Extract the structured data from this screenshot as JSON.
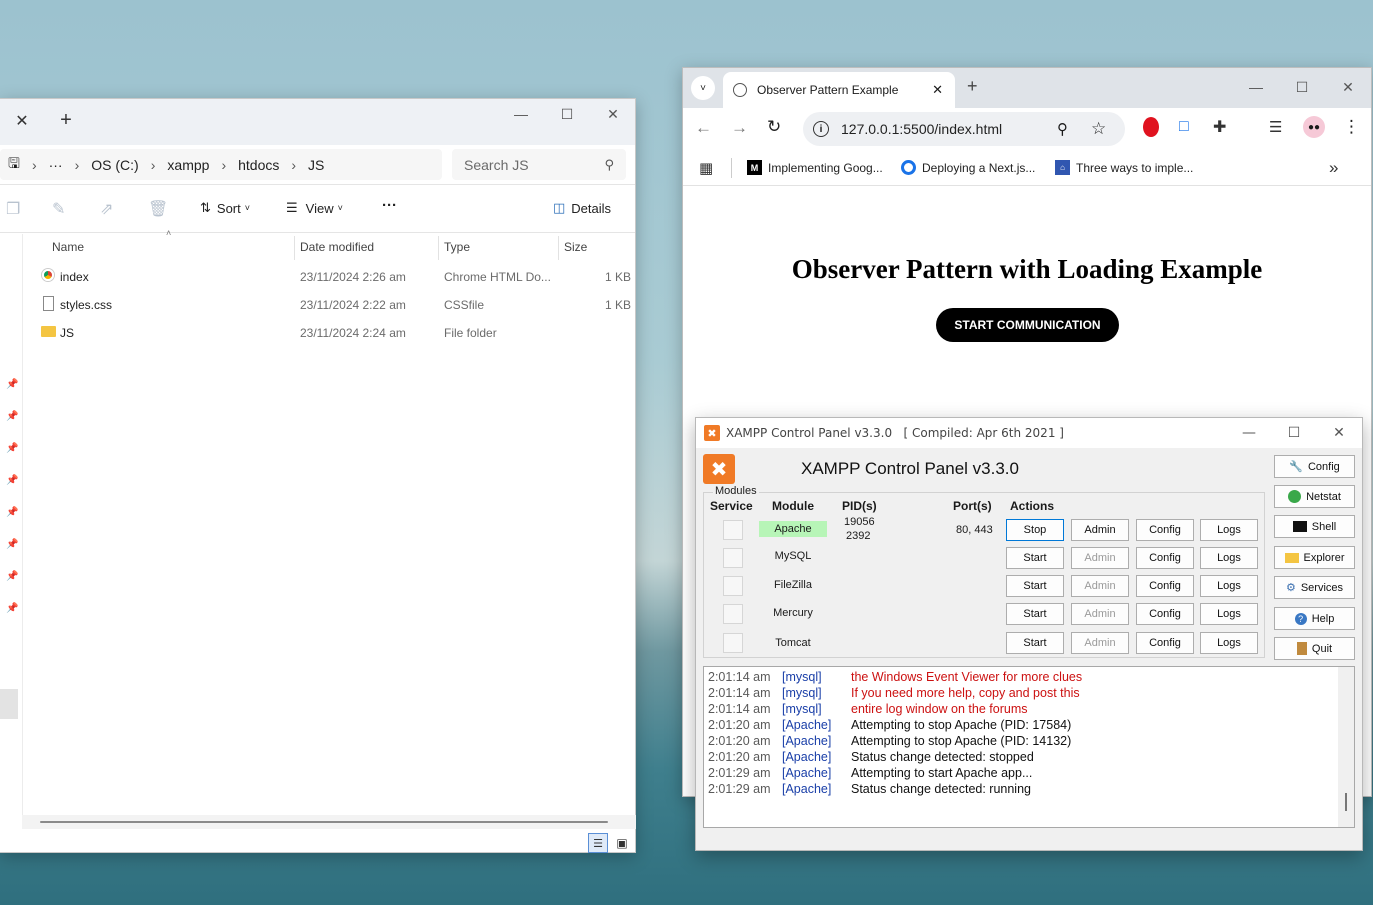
{
  "explorer": {
    "tab_close": "✕",
    "tab_new": "+",
    "breadcrumbs": [
      "OS (C:)",
      "xampp",
      "htdocs",
      "JS"
    ],
    "more": "···",
    "search_placeholder": "Search JS",
    "toolbar": {
      "sort": "Sort",
      "view": "View",
      "more": "···",
      "details": "Details"
    },
    "columns": {
      "name": "Name",
      "date": "Date modified",
      "type": "Type",
      "size": "Size"
    },
    "files": [
      {
        "name": "index",
        "date": "23/11/2024 2:26 am",
        "type": "Chrome HTML Do...",
        "size": "1 KB",
        "icon": "chrome-html-icon"
      },
      {
        "name": "styles.css",
        "date": "23/11/2024 2:22 am",
        "type": "CSSfile",
        "size": "1 KB",
        "icon": "file-icon"
      },
      {
        "name": "JS",
        "date": "23/11/2024 2:24 am",
        "type": "File folder",
        "size": "",
        "icon": "folder-icon"
      }
    ]
  },
  "browser": {
    "tab_title": "Observer Pattern Example",
    "url": "127.0.0.1:5500/index.html",
    "bookmarks": [
      "Implementing Goog...",
      "Deploying a Next.js...",
      "Three ways to imple..."
    ],
    "page": {
      "heading": "Observer Pattern with Loading Example",
      "button": "START COMMUNICATION"
    }
  },
  "xampp": {
    "window_title": "XAMPP Control Panel v3.3.0   [ Compiled: Apr 6th 2021 ]",
    "header": "XAMPP Control Panel v3.3.0",
    "modules_label": "Modules",
    "columns": {
      "service": "Service",
      "module": "Module",
      "pid": "PID(s)",
      "port": "Port(s)",
      "actions": "Actions"
    },
    "modules": [
      {
        "name": "Apache",
        "pid1": "19056",
        "pid2": "2392",
        "port": "80, 443",
        "action": "Stop",
        "admin": "Admin",
        "config": "Config",
        "logs": "Logs",
        "running": true
      },
      {
        "name": "MySQL",
        "pid1": "",
        "pid2": "",
        "port": "",
        "action": "Start",
        "admin": "Admin",
        "config": "Config",
        "logs": "Logs",
        "running": false
      },
      {
        "name": "FileZilla",
        "pid1": "",
        "pid2": "",
        "port": "",
        "action": "Start",
        "admin": "Admin",
        "config": "Config",
        "logs": "Logs",
        "running": false
      },
      {
        "name": "Mercury",
        "pid1": "",
        "pid2": "",
        "port": "",
        "action": "Start",
        "admin": "Admin",
        "config": "Config",
        "logs": "Logs",
        "running": false
      },
      {
        "name": "Tomcat",
        "pid1": "",
        "pid2": "",
        "port": "",
        "action": "Start",
        "admin": "Admin",
        "config": "Config",
        "logs": "Logs",
        "running": false
      }
    ],
    "side_buttons": [
      "Config",
      "Netstat",
      "Shell",
      "Explorer",
      "Services",
      "Help",
      "Quit"
    ],
    "log": [
      {
        "time": "2:01:14 am",
        "module": "[mysql]",
        "text": "the Windows Event Viewer for more clues",
        "color": "#cc1111"
      },
      {
        "time": "2:01:14 am",
        "module": "[mysql]",
        "text": "If you need more help, copy and post this",
        "color": "#cc1111"
      },
      {
        "time": "2:01:14 am",
        "module": "[mysql]",
        "text": "entire log window on the forums",
        "color": "#cc1111"
      },
      {
        "time": "2:01:20 am",
        "module": "[Apache]",
        "text": "Attempting to stop Apache (PID: 17584)",
        "color": "#111111"
      },
      {
        "time": "2:01:20 am",
        "module": "[Apache]",
        "text": "Attempting to stop Apache (PID: 14132)",
        "color": "#111111"
      },
      {
        "time": "2:01:20 am",
        "module": "[Apache]",
        "text": "Status change detected: stopped",
        "color": "#111111"
      },
      {
        "time": "2:01:29 am",
        "module": "[Apache]",
        "text": "Attempting to start Apache app...",
        "color": "#111111"
      },
      {
        "time": "2:01:29 am",
        "module": "[Apache]",
        "text": "Status change detected: running",
        "color": "#111111"
      }
    ]
  },
  "colors": {
    "accent": "#0078d7",
    "running_green": "#b7f5b7",
    "log_module": "#1a3fa8",
    "log_error": "#cc1111"
  }
}
